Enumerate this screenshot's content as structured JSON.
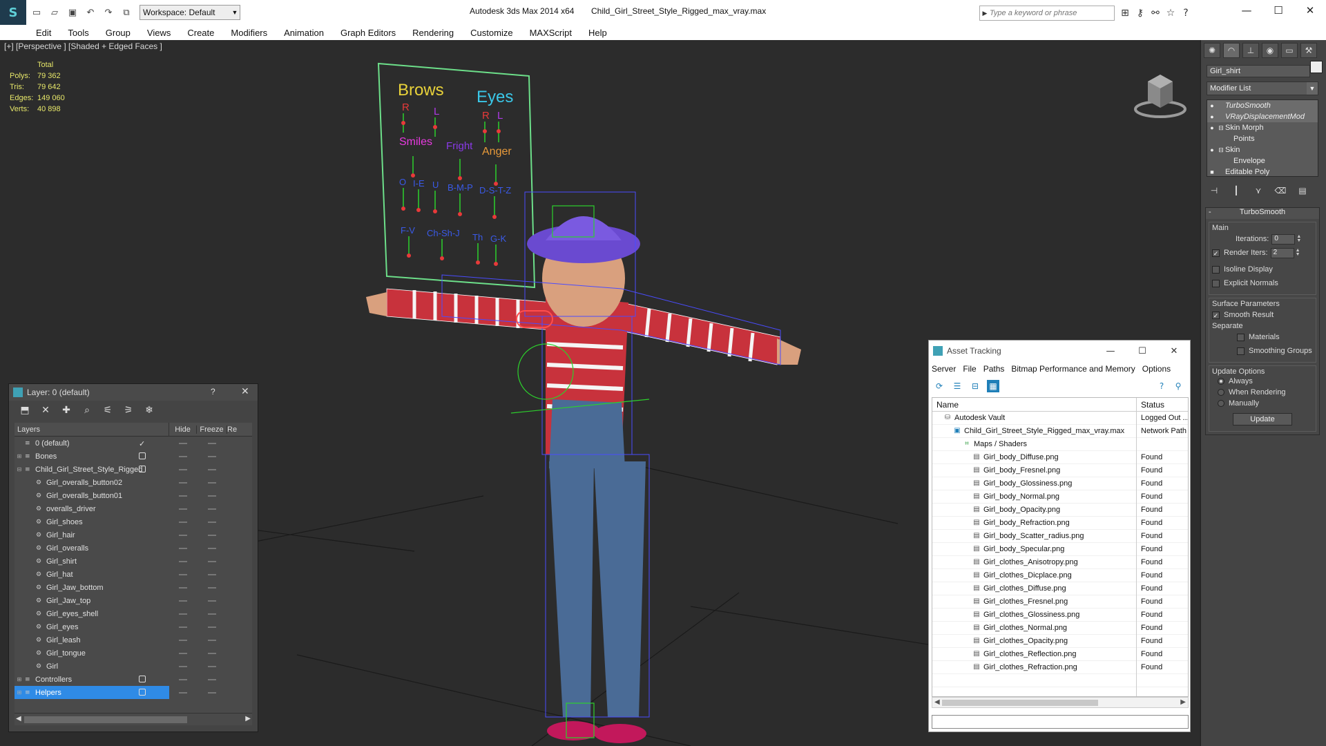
{
  "titlebar": {
    "app_title": "Autodesk 3ds Max  2014 x64",
    "file_title": "Child_Girl_Street_Style_Rigged_max_vray.max",
    "workspace": "Workspace: Default",
    "search_placeholder": "Type a keyword or phrase"
  },
  "menu": [
    "Edit",
    "Tools",
    "Group",
    "Views",
    "Create",
    "Modifiers",
    "Animation",
    "Graph Editors",
    "Rendering",
    "Customize",
    "MAXScript",
    "Help"
  ],
  "viewport": {
    "label": "[+] [Perspective ] [Shaded + Edged Faces ]",
    "stats": {
      "header": "Total",
      "rows": [
        {
          "k": "Polys:",
          "v": "79 362"
        },
        {
          "k": "Tris:",
          "v": "79 642"
        },
        {
          "k": "Edges:",
          "v": "149 060"
        },
        {
          "k": "Verts:",
          "v": "40 898"
        }
      ]
    },
    "board": {
      "brows": "Brows",
      "eyes": "Eyes",
      "r1": "R",
      "l1": "L",
      "r2": "R",
      "l2": "L",
      "smiles": "Smiles",
      "fright": "Fright",
      "anger": "Anger",
      "o": "O",
      "ie": "I-E",
      "u": "U",
      "bmp": "B-M-P",
      "dstz": "D-S-T-Z",
      "fv": "F-V",
      "chsh": "Ch-Sh-J",
      "th": "Th",
      "gk": "G-K"
    }
  },
  "command_panel": {
    "object_name": "Girl_shirt",
    "modifier_list": "Modifier List",
    "stack": [
      {
        "label": "TurboSmooth",
        "kind": "mod",
        "hl": true
      },
      {
        "label": "VRayDisplacementMod",
        "kind": "mod",
        "hl": true
      },
      {
        "label": "Skin Morph",
        "kind": "mod"
      },
      {
        "label": "Points",
        "kind": "sub"
      },
      {
        "label": "Skin",
        "kind": "mod"
      },
      {
        "label": "Envelope",
        "kind": "sub"
      },
      {
        "label": "Editable Poly",
        "kind": "base"
      }
    ],
    "rollout_title": "TurboSmooth",
    "main_label": "Main",
    "iterations_label": "Iterations:",
    "iterations_value": "0",
    "render_iters_label": "Render Iters:",
    "render_iters_value": "2",
    "isoline": "Isoline Display",
    "explicit": "Explicit Normals",
    "surface_label": "Surface Parameters",
    "smooth_result": "Smooth Result",
    "separate": "Separate",
    "materials": "Materials",
    "smoothing_groups": "Smoothing Groups",
    "update_options": "Update Options",
    "always": "Always",
    "when_rendering": "When Rendering",
    "manually": "Manually",
    "update_btn": "Update"
  },
  "layer_window": {
    "title": "Layer: 0 (default)",
    "help": "?",
    "columns": {
      "layers": "Layers",
      "hide": "Hide",
      "freeze": "Freeze",
      "r": "Re"
    },
    "rows": [
      {
        "name": "0 (default)",
        "level": 0,
        "type": "layer",
        "check": "tick",
        "expander": ""
      },
      {
        "name": "Bones",
        "level": 0,
        "type": "layer",
        "check": "box",
        "expander": "+"
      },
      {
        "name": "Child_Girl_Street_Style_Rigged",
        "level": 0,
        "type": "layer",
        "check": "box",
        "expander": "−"
      },
      {
        "name": "Girl_overalls_button02",
        "level": 1,
        "type": "obj",
        "check": "",
        "expander": ""
      },
      {
        "name": "Girl_overalls_button01",
        "level": 1,
        "type": "obj",
        "check": "",
        "expander": ""
      },
      {
        "name": "overalls_driver",
        "level": 1,
        "type": "obj",
        "check": "",
        "expander": ""
      },
      {
        "name": "Girl_shoes",
        "level": 1,
        "type": "obj",
        "check": "",
        "expander": ""
      },
      {
        "name": "Girl_hair",
        "level": 1,
        "type": "obj",
        "check": "",
        "expander": ""
      },
      {
        "name": "Girl_overalls",
        "level": 1,
        "type": "obj",
        "check": "",
        "expander": ""
      },
      {
        "name": "Girl_shirt",
        "level": 1,
        "type": "obj",
        "check": "",
        "expander": ""
      },
      {
        "name": "Girl_hat",
        "level": 1,
        "type": "obj",
        "check": "",
        "expander": ""
      },
      {
        "name": "Girl_Jaw_bottom",
        "level": 1,
        "type": "obj",
        "check": "",
        "expander": ""
      },
      {
        "name": "Girl_Jaw_top",
        "level": 1,
        "type": "obj",
        "check": "",
        "expander": ""
      },
      {
        "name": "Girl_eyes_shell",
        "level": 1,
        "type": "obj",
        "check": "",
        "expander": ""
      },
      {
        "name": "Girl_eyes",
        "level": 1,
        "type": "obj",
        "check": "",
        "expander": ""
      },
      {
        "name": "Girl_leash",
        "level": 1,
        "type": "obj",
        "check": "",
        "expander": ""
      },
      {
        "name": "Girl_tongue",
        "level": 1,
        "type": "obj",
        "check": "",
        "expander": ""
      },
      {
        "name": "Girl",
        "level": 1,
        "type": "obj",
        "check": "",
        "expander": ""
      },
      {
        "name": "Controllers",
        "level": 0,
        "type": "layer",
        "check": "box",
        "expander": "+"
      },
      {
        "name": "Helpers",
        "level": 0,
        "type": "layer",
        "check": "box",
        "expander": "+",
        "selected": true
      }
    ]
  },
  "asset_window": {
    "title": "Asset Tracking",
    "menu": [
      "Server",
      "File",
      "Paths",
      "Bitmap Performance and Memory",
      "Options"
    ],
    "columns": {
      "name": "Name",
      "status": "Status"
    },
    "rows": [
      {
        "name": "Autodesk Vault",
        "status": "Logged Out ...",
        "indent": 1,
        "icon": "vault"
      },
      {
        "name": "Child_Girl_Street_Style_Rigged_max_vray.max",
        "status": "Network Path",
        "indent": 2,
        "icon": "max"
      },
      {
        "name": "Maps / Shaders",
        "status": "",
        "indent": 3,
        "icon": "maps"
      },
      {
        "name": "Girl_body_Diffuse.png",
        "status": "Found",
        "indent": 4,
        "icon": "file"
      },
      {
        "name": "Girl_body_Fresnel.png",
        "status": "Found",
        "indent": 4,
        "icon": "file"
      },
      {
        "name": "Girl_body_Glossiness.png",
        "status": "Found",
        "indent": 4,
        "icon": "file"
      },
      {
        "name": "Girl_body_Normal.png",
        "status": "Found",
        "indent": 4,
        "icon": "file"
      },
      {
        "name": "Girl_body_Opacity.png",
        "status": "Found",
        "indent": 4,
        "icon": "file"
      },
      {
        "name": "Girl_body_Refraction.png",
        "status": "Found",
        "indent": 4,
        "icon": "file"
      },
      {
        "name": "Girl_body_Scatter_radius.png",
        "status": "Found",
        "indent": 4,
        "icon": "file"
      },
      {
        "name": "Girl_body_Specular.png",
        "status": "Found",
        "indent": 4,
        "icon": "file"
      },
      {
        "name": "Girl_clothes_Anisotropy.png",
        "status": "Found",
        "indent": 4,
        "icon": "file"
      },
      {
        "name": "Girl_clothes_Dicplace.png",
        "status": "Found",
        "indent": 4,
        "icon": "file"
      },
      {
        "name": "Girl_clothes_Diffuse.png",
        "status": "Found",
        "indent": 4,
        "icon": "file"
      },
      {
        "name": "Girl_clothes_Fresnel.png",
        "status": "Found",
        "indent": 4,
        "icon": "file"
      },
      {
        "name": "Girl_clothes_Glossiness.png",
        "status": "Found",
        "indent": 4,
        "icon": "file"
      },
      {
        "name": "Girl_clothes_Normal.png",
        "status": "Found",
        "indent": 4,
        "icon": "file"
      },
      {
        "name": "Girl_clothes_Opacity.png",
        "status": "Found",
        "indent": 4,
        "icon": "file"
      },
      {
        "name": "Girl_clothes_Reflection.png",
        "status": "Found",
        "indent": 4,
        "icon": "file"
      },
      {
        "name": "Girl_clothes_Refraction.png",
        "status": "Found",
        "indent": 4,
        "icon": "file"
      }
    ]
  },
  "colors": {
    "viewport_bg": "#2c2c2c",
    "panel_bg": "#444444",
    "selection": "#2f8be6",
    "stats_text": "#e8e86a",
    "wire_blue": "#4a4cff",
    "wire_green": "#2cd12c"
  }
}
